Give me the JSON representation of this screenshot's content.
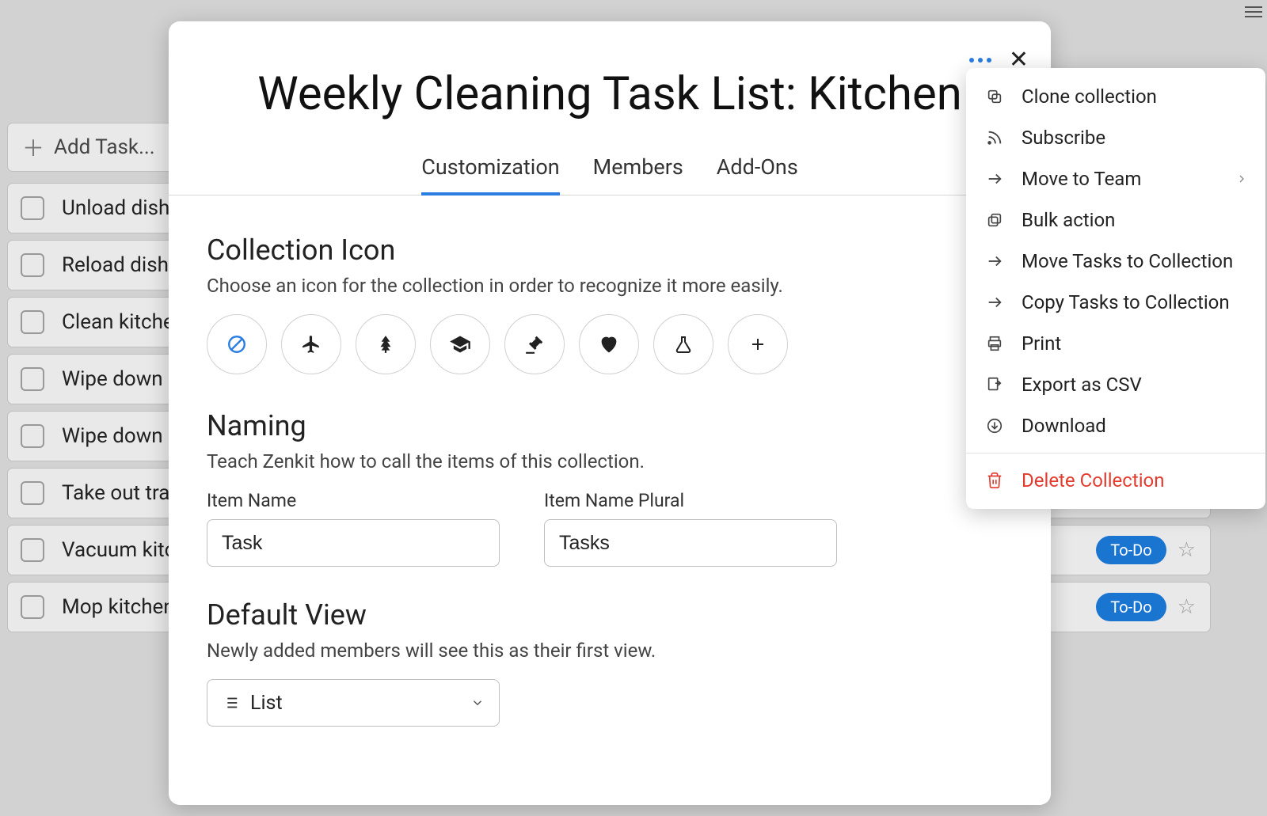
{
  "background": {
    "add_task_label": "Add Task...",
    "tasks": [
      "Unload dishwasher",
      "Reload dishwasher",
      "Clean kitchen",
      "Wipe down",
      "Wipe down",
      "Take out trash",
      "Vacuum kitchen",
      "Mop kitchen"
    ],
    "badge_label": "To-Do"
  },
  "modal": {
    "title": "Weekly Cleaning Task List: Kitchen",
    "tabs": {
      "customization": "Customization",
      "members": "Members",
      "addons": "Add-Ons"
    },
    "collection_icon": {
      "heading": "Collection Icon",
      "sub": "Choose an icon for the collection in order to recognize it more easily.",
      "options": [
        "none",
        "plane",
        "tree",
        "graduation",
        "gavel",
        "heart",
        "flask",
        "add"
      ]
    },
    "naming": {
      "heading": "Naming",
      "sub": "Teach Zenkit how to call the items of this collection.",
      "item_label": "Item Name",
      "item_value": "Task",
      "plural_label": "Item Name Plural",
      "plural_value": "Tasks"
    },
    "default_view": {
      "heading": "Default View",
      "sub": "Newly added members will see this as their first view.",
      "value": "List"
    }
  },
  "menu": {
    "clone": "Clone collection",
    "subscribe": "Subscribe",
    "move_team": "Move to Team",
    "bulk": "Bulk action",
    "move_tasks": "Move Tasks to Collection",
    "copy_tasks": "Copy Tasks to Collection",
    "print": "Print",
    "export_csv": "Export as CSV",
    "download": "Download",
    "delete": "Delete Collection"
  }
}
